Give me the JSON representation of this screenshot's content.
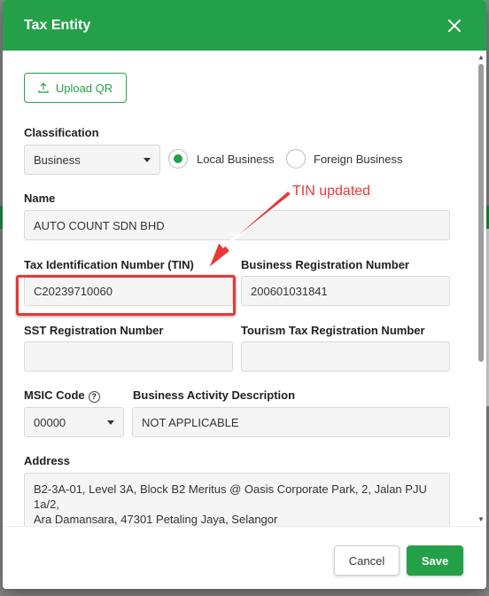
{
  "modal": {
    "title": "Tax Entity",
    "close_icon": "close-icon",
    "upload_qr_label": "Upload QR",
    "classification_label": "Classification",
    "classification_value": "Business",
    "radio_local_label": "Local Business",
    "radio_foreign_label": "Foreign Business",
    "radio_selected": "Local Business",
    "name_label": "Name",
    "name_value": "AUTO COUNT SDN BHD",
    "tin_label": "Tax Identification Number (TIN)",
    "tin_value": "C20239710060",
    "brn_label": "Business Registration Number",
    "brn_value": "200601031841",
    "sst_label": "SST Registration Number",
    "sst_value": "",
    "tourism_label": "Tourism Tax Registration Number",
    "tourism_value": "",
    "msic_label": "MSIC Code",
    "msic_value": "00000",
    "activity_label": "Business Activity Description",
    "activity_value": "NOT APPLICABLE",
    "address_label": "Address",
    "address_line1": "B2-3A-01, Level 3A, Block B2 Meritus @ Oasis Corporate Park, 2, Jalan PJU 1a/2,",
    "address_line2": "Ara Damansara, 47301 Petaling Jaya, Selangor",
    "cancel_label": "Cancel",
    "save_label": "Save"
  },
  "annotation": {
    "text": "TIN updated",
    "color": "#e53935"
  },
  "colors": {
    "accent": "#24a148"
  }
}
